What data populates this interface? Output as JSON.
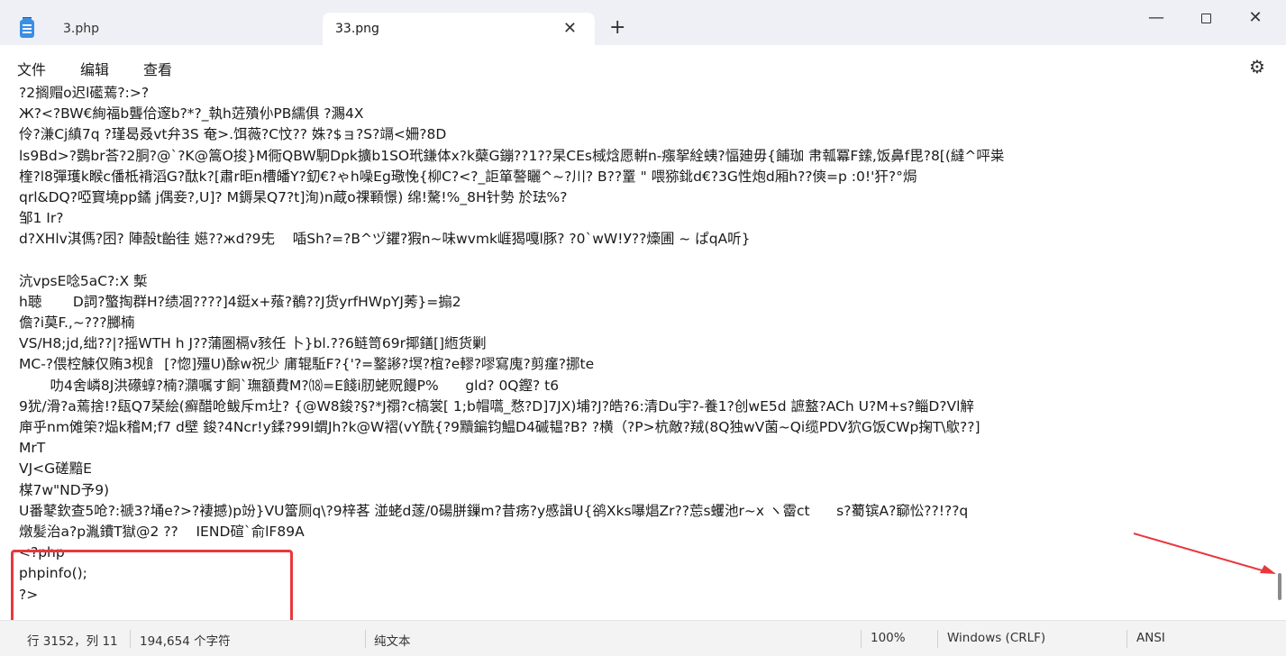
{
  "window": {
    "tabs": [
      {
        "label": "3.php"
      },
      {
        "label": "33.png"
      }
    ],
    "tab_close_glyph": "✕",
    "new_tab_glyph": "+",
    "minimize_glyph": "—",
    "close_glyph": "✕"
  },
  "menu": {
    "file": "文件",
    "edit": "编辑",
    "view": "查看",
    "settings_glyph": "⚙"
  },
  "editor": {
    "lines": [
      "?2搁赗o迟l礷蔫?:>?",
      "Ж?<?BW€絢福b聾佮邃b?*?_執h菦殨仦PB繻俱 ?瀃4X",
      "伶?溓Cj縝7q ?瑾曷叒vt弁3S 奄>.饵薇?C忟?? 姝?$ョ?S?竵<姍?8D",
      "ls9Bd>?鷃br荅?2胴?@`?K@篙O捘}M衕QBW駉Dpk擴b1SO玳鎌体x?k蘗G鏰??1??杲CEs棫焓愿輧n-瘬挐絟蛦?愊廸毋{餔珈 帇瓡冪F鎍,饭鼻f毘?8[(繨^呯粜",
      "楏?l8彈瓁k睺c僠柢褙滔G?酞k?[肅r昛n槽皤Y?釖€?ゃh噪Eg璥悗{柳C?<?_詎箪謷矖^~?川? B??罿 \" 喂猕鉳d€?3G性炮d厢h??傸=p :0!'犴?°焗",
      "qrl&DQ?啞寳墝pp鐍 j偶妾?,U]? M鎒杲Q7?t]洵)n蔵o祼顐憬) 绵!驁!%_8H针勢 於珐%?",
      "邹1 Ir?",
      "d?XHlv淇傌?囨? 陣嗀t齝徍 嬨??жd?9兂    喢Sh?=?B^ヅ鑺?猳n~味wvmk崕猲嘎l豚? ?0`wW!У??燺圃 ~ ぱqA听}",
      "",
      "沆vpsE唸5aC?:X 槧",
      "h聴       D詞?蟼掏群H?绩凅????]4鋌x+薞?鶺??J货yrfHWpYJ莠}=搧2",
      "儋?i莫F.,~???膷楠",
      "VS/H8;jd,绌??|?摇WTH h J??蒲圏槅v豥任 卜}bl.??6鲢笥69r揶鐥[]緪货剿",
      "MC-?偎椌觫仅贿3枧飠 [?惚]殭U)酴w祝少 庯辊駈F?{'?=鐜謻?塓?椬?e轇?嘐寫廆?剪瘽?挪te",
      "       叻4舍嶙8J洪礤蜳?楠?濻嘱す餇`璑額費M?⒅=E餞i肕蛯贶饅P%      gld? 0Q鏗? t6",
      "9犹/滑?a蔫捨!?瓺Q7琹絵(癬醋呛鲅斥m圵? {@W8鋑?§?*J禤?c槁裳[ 1;b帽嚆_愗?D]7JX)埔?J?皓?6:清Du宇?-養1?创wE5d 謶盩?ACh U?M+s?鲻D?Vl觪",
      "庘乎nm傩筞?煰k稽M;f7 d壁 鋑?4Ncr!y鍒?99l蝟Jh?k@W褶(vY酰{?9黷鍽钧鰛D4磩韫?B? ?横（?P>杭敵?羢(8Q独wV菌~Qi缆PDV狖G饭CWp掬T\\歍??]",
      "MrT",
      "VJ<G磋黯E",
      "楳7w\"ND予9)",
      "U番鼕欽查5呛?:禠3?埇e?>?褄撼)p竕}VU簹厕q\\?9梓茖 湴蛯d蓫/0碭胼鏁m?昔疡?y慼諿U{鹆Xks嚗焻Zr??莣s蠼池r~x ヽ霤ct      s?薥镔A?窷忪??!??q",
      "燉髪治a?p湚鐨T獄@2 ??    IEND碹`俞lF89A",
      "<?php",
      "phpinfo();",
      "?>"
    ]
  },
  "status": {
    "position": "行 3152，列 11",
    "char_count": "194,654 个字符",
    "format": "纯文本",
    "zoom": "100%",
    "line_ending": "Windows (CRLF)",
    "encoding": "ANSI"
  },
  "colors": {
    "highlight": "#e8383d",
    "titlebar": "#eef0f5",
    "statusbar": "#f3f3f3"
  }
}
